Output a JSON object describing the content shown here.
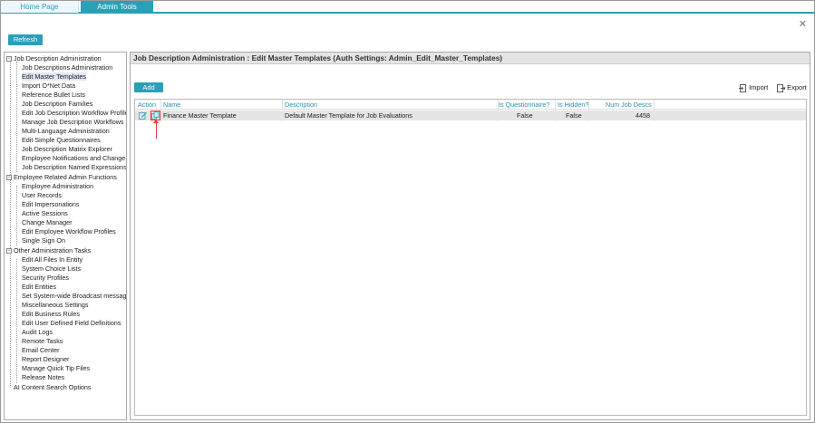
{
  "tabs": [
    {
      "label": "Home Page",
      "active": false
    },
    {
      "label": "Admin Tools",
      "active": true
    }
  ],
  "toolbar": {
    "refresh_label": "Refresh"
  },
  "tree": {
    "groups": [
      {
        "label": "Job Description Administration",
        "items": [
          "Job Descriptions Administration",
          "Edit Master Templates",
          "Import O*Net Data",
          "Reference Bullet Lists",
          "Job Description Families",
          "Edit Job Description Workflow Profile",
          "Manage Job Description Workflows",
          "Multi-Language Administration",
          "Edit Simple Questionnaires",
          "Job Description Matrix Explorer",
          "Employee Notifications and Change",
          "Job Description Named Expressions"
        ]
      },
      {
        "label": "Employee Related Admin Functions",
        "items": [
          "Employee Administration",
          "User Records",
          "Edit Impersonations",
          "Active Sessions",
          "Change Manager",
          "Edit Employee Workflow Profiles",
          "Single Sign On"
        ]
      },
      {
        "label": "Other Administration Tasks",
        "items": [
          "Edit All Files In Entity",
          "System Choice Lists",
          "Security Profiles",
          "Edit Entities",
          "Set System-wide Broadcast messag",
          "Miscellaneous Settings",
          "Edit Business Rules",
          "Edit User Defined Field Definitions",
          "Audit Logs",
          "Remote Tasks",
          "Email Center",
          "Report Designer",
          "Manage Quick Tip Files",
          "Release Notes"
        ]
      }
    ],
    "extra_item": "AI Content Search Options",
    "selected": "Edit Master Templates"
  },
  "main": {
    "title": "Job Description Administration : Edit Master Templates (Auth Settings: Admin_Edit_Master_Templates)",
    "add_label": "Add",
    "import_label": "Import",
    "export_label": "Export",
    "columns": [
      "Action",
      "Name",
      "Description",
      "Is Questionnaire?",
      "Is Hidden?",
      "Num Job Descs"
    ],
    "rows": [
      {
        "name": "Finance Master Template",
        "description": "Default Master Template for Job Evaluations",
        "is_questionnaire": "False",
        "is_hidden": "False",
        "num_job_descs": "4458"
      }
    ]
  },
  "colors": {
    "accent": "#2aa0b8",
    "header_text": "#2a8fb3",
    "highlight": "#e23b3b"
  }
}
